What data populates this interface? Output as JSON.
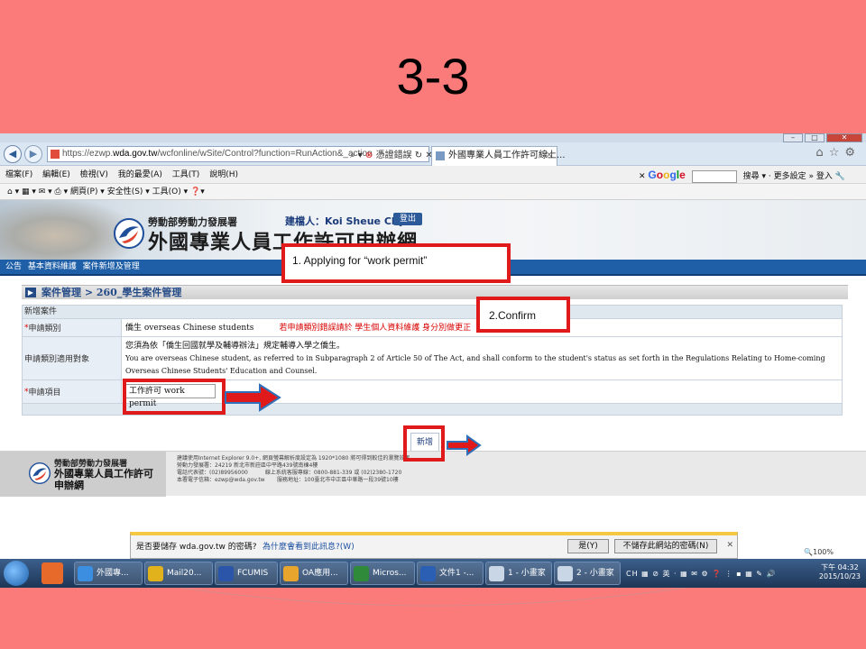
{
  "slide": {
    "title": "3-3"
  },
  "browser": {
    "address_url_prefix": "https://ezwp.",
    "address_url_domain": "wda.gov.tw",
    "address_url_rest": "/wcfonline/wSite/Control?function=RunAction&_action",
    "cert_error": "憑證錯誤",
    "tab_title": "外國專業人員工作許可線上...",
    "menu_items": [
      "檔案(F)",
      "編輯(E)",
      "檢視(V)",
      "我的最愛(A)",
      "工具(T)",
      "說明(H)"
    ],
    "google_label": "Google",
    "search_label": "搜尋",
    "more_settings": "更多設定",
    "login_label": "登入",
    "command_bar": "網頁(P) ▾   安全性(S) ▾   工具(O) ▾"
  },
  "banner": {
    "ministry": "勞動部勞動力發展署",
    "site_name": "外國專業人員工作許可申辦網",
    "user_label": "建檔人：Koi Sheue Chyi",
    "logout": "登出"
  },
  "nav": {
    "items": [
      "公告",
      "基本資料維護",
      "案件新增及管理"
    ]
  },
  "breadcrumb": "案件管理 > 260_學生案件管理",
  "form": {
    "section_header": "新增案件",
    "rows": [
      {
        "label_req": "*",
        "label": "申請類別",
        "value": "僑生 overseas Chinese students",
        "note": "若申請類別錯誤請於 學生個人資料維護 身分別做更正"
      },
      {
        "label": "申請類別適用對象",
        "value_line1": "您須為依「僑生回國就學及輔導辦法」規定輔導入學之僑生。",
        "value_line2": "You are overseas Chinese student, as referred to in Subparagraph 2 of Article 50 of The Act, and shall conform to the student's status as set forth in the Regulations Relating to Home-coming Overseas Chinese Students' Education and Counsel."
      },
      {
        "label_req": "*",
        "label": "申請項目",
        "select_value": "工作許可 work permit"
      }
    ],
    "add_button": "新增"
  },
  "footer": {
    "ministry": "勞動部勞動力發展署",
    "site_name": "外國專業人員工作許可申辦網",
    "info": "建議使用Internet Explorer 9.0+, 網頁螢幕解析度設定為 1920*1080 將可得到較佳的瀏覽效果\n勞動力發展署：24219 新北市新莊區中平路439號南棟4樓\n電話代表號：(02)89956000          線上系統客服專線：0800-881-339 或 (02)2380-1720\n本署電子信箱：ezwp@wda.gov.tw       服務地址：100臺北市中正區中華路一段39號10樓"
  },
  "notify_bar": {
    "question": "是否要儲存 wda.gov.tw 的密碼?",
    "why_link": "為什麼會看到此訊息?(W)",
    "yes_button": "是(Y)",
    "no_button": "不儲存此網站的密碼(N)"
  },
  "zoom": "🔍100%",
  "taskbar": {
    "items": [
      "外國專...",
      "Mail20...",
      "FCUMIS",
      "OA應用...",
      "Micros...",
      "文件1 -...",
      "1 - 小畫家",
      "2 - 小畫家"
    ],
    "tray_text": "CH",
    "clock_line1": "下午 04:32",
    "clock_line2": "2015/10/23"
  },
  "annotations": {
    "step1": "1.      Applying for “work permit”",
    "step2": "2.Confirm"
  },
  "colors": {
    "annotation_red": "#e01a1a",
    "slide_bg": "#fb7a7a",
    "nav_blue": "#1e5fa8"
  }
}
